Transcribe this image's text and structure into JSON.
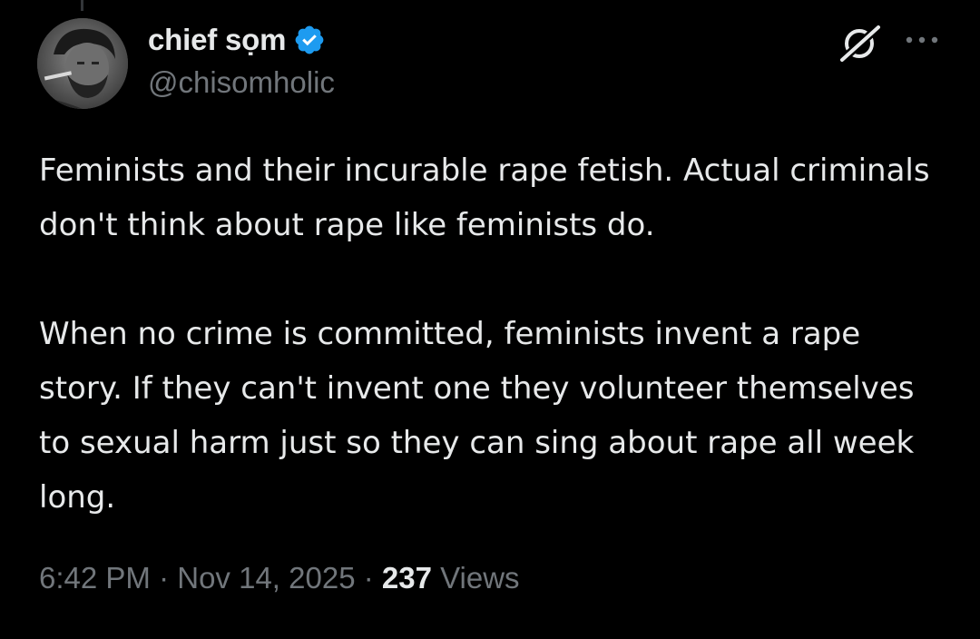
{
  "author": {
    "display_name": "chief sọm",
    "handle": "@chisomholic",
    "verified": true
  },
  "tweet": {
    "paragraphs": [
      "Feminists and their incurable rape fetish. Actual criminals don't think about rape like feminists do.",
      "When no crime is committed, feminists invent a rape story. If they can't invent one they volunteer themselves to sexual harm just so they can sing about rape all week long."
    ]
  },
  "meta": {
    "time": "6:42 PM",
    "separator_1": " · ",
    "date": "Nov 14, 2025",
    "separator_2": " · ",
    "views_count": "237",
    "views_label": " Views"
  },
  "icons": {
    "verified": "verified-badge-icon",
    "grok": "grok-icon",
    "more": "more-options-icon"
  },
  "colors": {
    "background": "#000000",
    "text_primary": "#e7e9ea",
    "text_secondary": "#71767b",
    "verified_blue": "#1d9bf0"
  }
}
